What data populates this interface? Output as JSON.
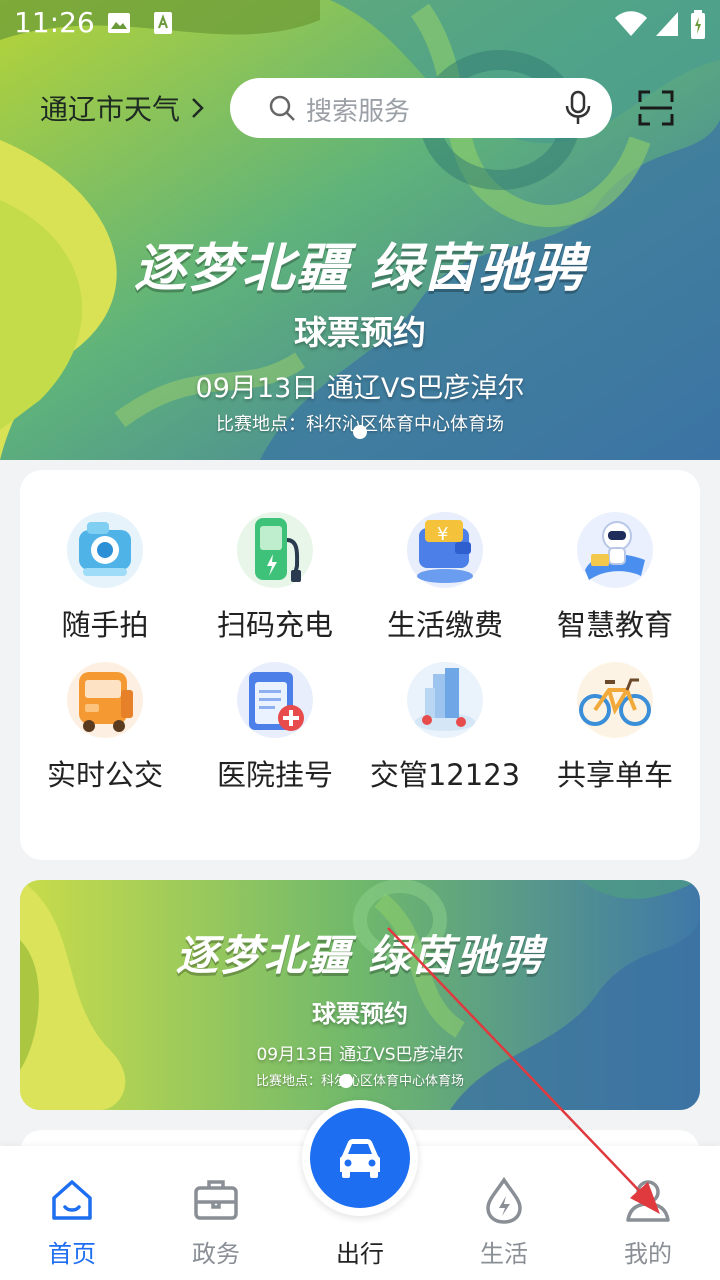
{
  "status": {
    "time": "11:26"
  },
  "header": {
    "weather": "通辽市天气",
    "search_placeholder": "搜索服务"
  },
  "hero_banner": {
    "title": "逐梦北疆 绿茵驰骋",
    "subtitle": "球票预约",
    "date_line": "09月13日 通辽VS巴彦淖尔",
    "venue_line": "比赛地点：科尔沁区体育中心体育场"
  },
  "services": [
    {
      "label": "随手拍",
      "icon": "camera-icon"
    },
    {
      "label": "扫码充电",
      "icon": "charging-station-icon"
    },
    {
      "label": "生活缴费",
      "icon": "wallet-icon"
    },
    {
      "label": "智慧教育",
      "icon": "robot-icon"
    },
    {
      "label": "实时公交",
      "icon": "bus-icon"
    },
    {
      "label": "医院挂号",
      "icon": "clipboard-medical-icon"
    },
    {
      "label": "交管12123",
      "icon": "city-map-icon"
    },
    {
      "label": "共享单车",
      "icon": "bicycle-icon"
    }
  ],
  "promo_banner": {
    "title": "逐梦北疆 绿茵驰骋",
    "subtitle": "球票预约",
    "date_line": "09月13日 通辽VS巴彦淖尔",
    "venue_line": "比赛地点：科尔沁区体育中心体育场"
  },
  "nav": {
    "tabs": [
      {
        "label": "首页",
        "active": true
      },
      {
        "label": "政务",
        "active": false
      },
      {
        "label": "出行",
        "active": false
      },
      {
        "label": "生活",
        "active": false
      },
      {
        "label": "我的",
        "active": false
      }
    ]
  },
  "colors": {
    "accent": "#1e6ef1",
    "active_tab": "#1e6ef1",
    "inactive_tab": "#8a8f96",
    "annotation_arrow": "#e0393e"
  }
}
